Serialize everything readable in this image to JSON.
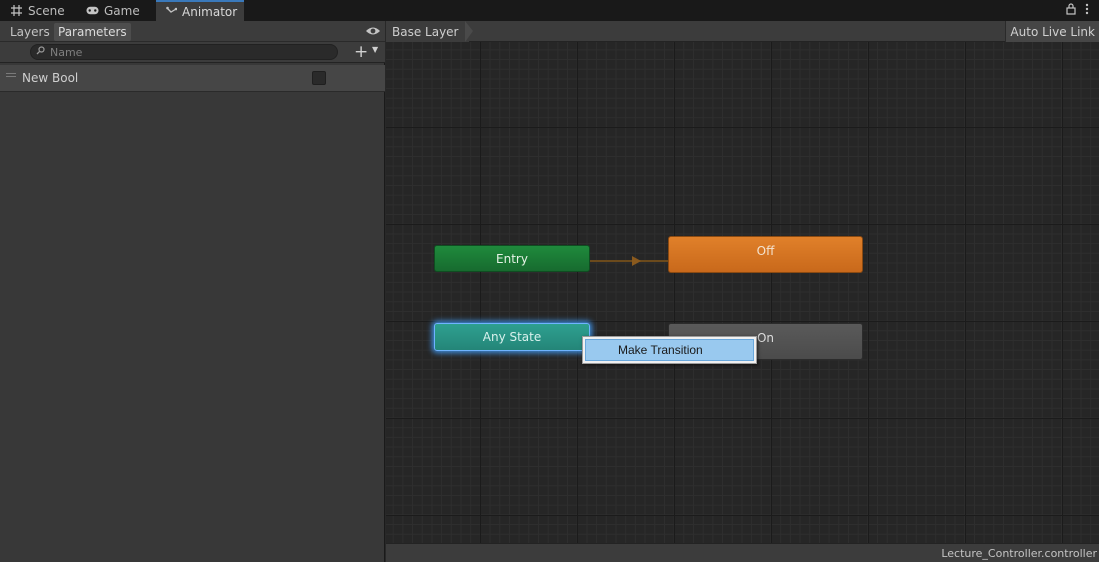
{
  "tabs": [
    {
      "label": "Scene",
      "icon": "grid-icon"
    },
    {
      "label": "Game",
      "icon": "gamepad-icon"
    },
    {
      "label": "Animator",
      "icon": "animator-icon",
      "active": true
    }
  ],
  "window_controls": {
    "lock_icon": "lock-icon",
    "menu_icon": "kebab-menu-icon"
  },
  "left_panel": {
    "tabs": {
      "layers": "Layers",
      "parameters": "Parameters"
    },
    "search": {
      "placeholder": "Name",
      "value": ""
    },
    "parameters": [
      {
        "name": "New Bool",
        "type": "bool",
        "value": false
      }
    ]
  },
  "graph": {
    "breadcrumb": "Base Layer",
    "auto_live_link": "Auto Live Link",
    "states": {
      "entry": "Entry",
      "off": "Off",
      "any_state": "Any State",
      "on": "On"
    },
    "context_menu": {
      "item": "Make Transition"
    },
    "file_name": "Lecture_Controller.controller"
  },
  "colors": {
    "entry": "#1f8a3c",
    "default_state": "#e0802a",
    "any_state": "#2ea090",
    "state": "#5a5a5a",
    "selection": "#6fb3ff",
    "menu_highlight": "#99c9ef"
  }
}
